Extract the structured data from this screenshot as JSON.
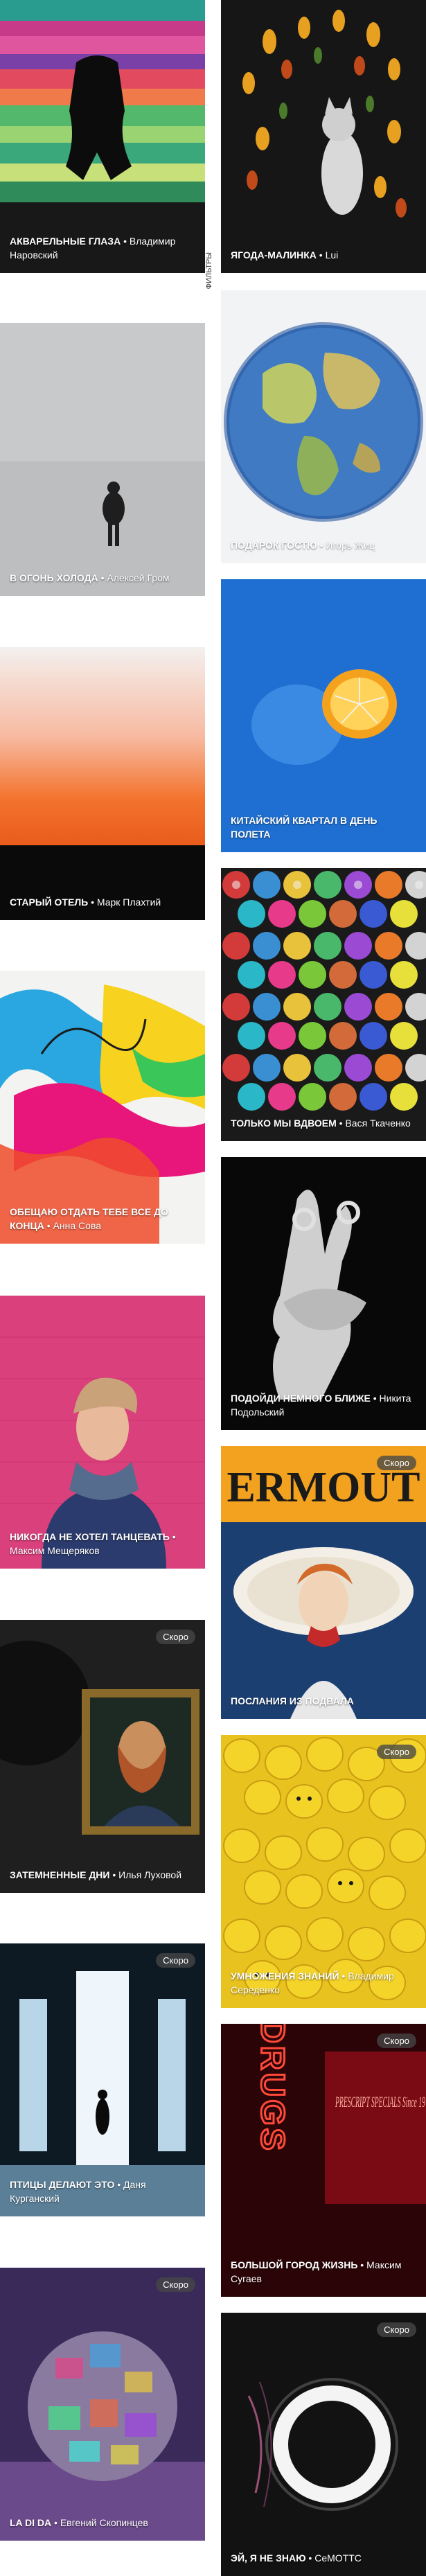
{
  "side_label": "ФИЛЬТРЫ",
  "left": [
    {
      "title": "АКВАРЕЛЬНЫЕ ГЛАЗА",
      "author": "Владимир Наровский",
      "badge": ""
    },
    {
      "title": "В ОГОНЬ ХОЛОДА",
      "author": "Алексей Гром",
      "badge": ""
    },
    {
      "title": "СТАРЫЙ ОТЕЛЬ",
      "author": "Марк Плахтий",
      "badge": ""
    },
    {
      "title": "ОБЕЩАЮ ОТДАТЬ ТЕБЕ ВСЕ ДО КОНЦА",
      "author": "Анна Сова",
      "badge": ""
    },
    {
      "title": "НИКОГДА НЕ ХОТЕЛ ТАНЦЕВАТЬ",
      "author": "Максим Мещеряков",
      "badge": ""
    },
    {
      "title": "ЗАТЕМНЕННЫЕ ДНИ",
      "author": "Илья Луховой",
      "badge": "Скоро"
    },
    {
      "title": "ПТИЦЫ ДЕЛАЮТ ЭТО",
      "author": "Даня Курганский",
      "badge": "Скоро"
    },
    {
      "title": "LA DI DA",
      "author": "Евгений Скопинцев",
      "badge": "Скоро"
    }
  ],
  "right": [
    {
      "title": "ЯГОДА-МАЛИНКА",
      "author": "Lui",
      "badge": ""
    },
    {
      "title": "ПОДАРОК ГОСТЮ",
      "author": "Игорь Жиц",
      "badge": ""
    },
    {
      "title": "КИТАЙСКИЙ КВАРТАЛ В ДЕНЬ ПОЛЕТА",
      "author": "",
      "badge": ""
    },
    {
      "title": "ТОЛЬКО МЫ ВДВОЕМ",
      "author": "Вася Ткаченко",
      "badge": ""
    },
    {
      "title": "ПОДОЙДИ НЕМНОГО БЛИЖЕ",
      "author": "Никита Подольский",
      "badge": ""
    },
    {
      "title": "ПОСЛАНИЯ ИЗ ПОДВАЛА",
      "author": "",
      "badge": "Скоро"
    },
    {
      "title": "УМНОЖЕНИЯ ЗНАНИЙ",
      "author": "Владимир Середенко",
      "badge": "Скоро"
    },
    {
      "title": "БОЛЬШОЙ ГОРОД ЖИЗНЬ",
      "author": "Максим Сугаев",
      "badge": "Скоро"
    },
    {
      "title": "ЭЙ, Я НЕ ЗНАЮ",
      "author": "CeMOTTC",
      "badge": "Скоро"
    }
  ],
  "art_words": {
    "poster": "ERMOUT",
    "neon": "DRUGS",
    "neon_sign": "PRESCRIPT SPECIALS Since 19"
  }
}
